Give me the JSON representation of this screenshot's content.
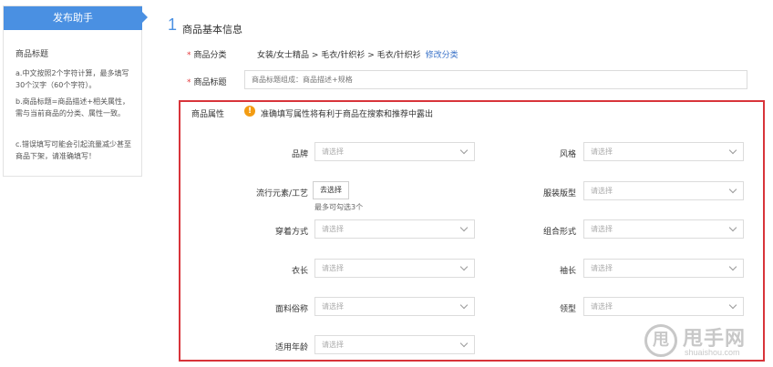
{
  "help": {
    "tab": "发布助手",
    "heading": "商品标题",
    "tips": [
      "a.中文按照2个字符计算，最多填写30个汉字（60个字符）。",
      "b.商品标题=商品描述+相关属性，需与当前商品的分类、属性一致。",
      "c.错误填写可能会引起流量减少甚至商品下架，请准确填写！"
    ]
  },
  "section": {
    "number": "1",
    "title": "商品基本信息"
  },
  "category": {
    "label": "商品分类",
    "path": "女装/女士精品 > 毛衣/针织衫 > 毛衣/针织衫",
    "edit": "修改分类"
  },
  "product_title": {
    "label": "商品标题",
    "placeholder": "商品标题组成：商品描述+规格"
  },
  "attributes": {
    "label": "商品属性",
    "warning_icon": "warning-icon",
    "warning": "准确填写属性将有利于商品在搜索和推荐中露出",
    "select_placeholder": "请选择",
    "choose_button": "去选择",
    "choose_hint": "最多可勾选3个",
    "fields": {
      "brand": "品牌",
      "style": "风格",
      "trend": "流行元素/工艺",
      "fit": "服装版型",
      "wear": "穿着方式",
      "combo": "组合形式",
      "length": "衣长",
      "sleeve": "袖长",
      "fabric": "面料俗称",
      "collar": "领型",
      "age": "适用年龄"
    }
  },
  "watermark": {
    "brand": "甩手网",
    "logo_char": "甩",
    "url": "shuaishou.com"
  },
  "colors": {
    "accent": "#4a90e2",
    "alert_border": "#d8343a",
    "warning": "#f39c12",
    "link": "#3b73c8"
  }
}
